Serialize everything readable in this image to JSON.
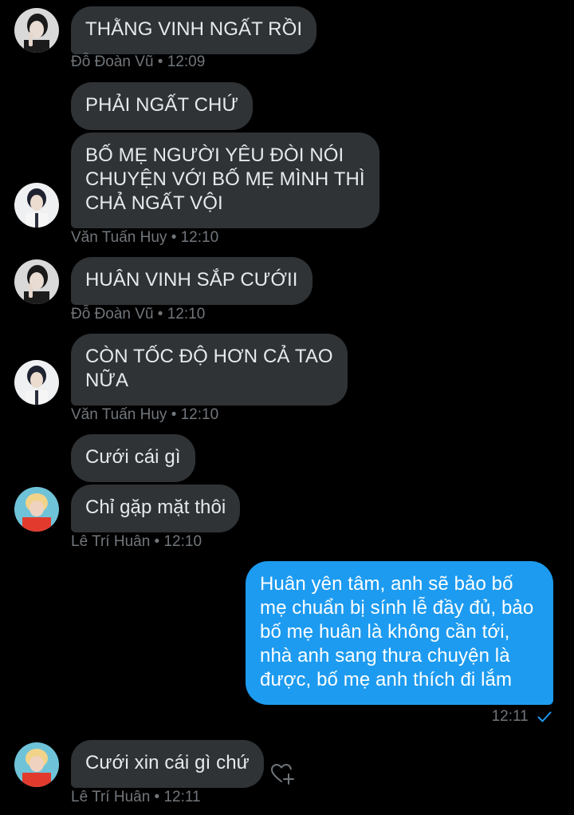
{
  "messages": [
    {
      "sender": "Đỗ Đoàn Vũ",
      "text": "THẰNG VINH NGẤT RỒI",
      "meta": "Đỗ Đoàn Vũ • 12:09"
    },
    {
      "sender": "Văn Tuấn Huy",
      "text": "PHẢI NGẤT CHỨ"
    },
    {
      "sender": "Văn Tuấn Huy",
      "text": "BỐ MẸ NGƯỜI YÊU ĐÒI NÓI\nCHUYỆN VỚI BỐ MẸ MÌNH THÌ\nCHẢ NGẤT VỘI",
      "meta": "Văn Tuấn Huy • 12:10"
    },
    {
      "sender": "Đỗ Đoàn Vũ",
      "text": "HUÂN VINH SẮP CƯỚII",
      "meta": "Đỗ Đoàn Vũ • 12:10"
    },
    {
      "sender": "Văn Tuấn Huy",
      "text": "CÒN TỐC ĐỘ HƠN CẢ TAO\nNỮA",
      "meta": "Văn Tuấn Huy • 12:10"
    },
    {
      "sender": "Lê Trí Huân",
      "text": "Cưới cái gì"
    },
    {
      "sender": "Lê Trí Huân",
      "text": "Chỉ gặp mặt thôi",
      "meta": "Lê Trí Huân • 12:10"
    },
    {
      "sender": "me",
      "text": "Huân yên tâm, anh sẽ bảo bố\nmẹ chuẩn bị sính lễ đầy đủ, bảo\nbố mẹ huân là không cần tới,\nnhà anh sang thưa chuyện là\nđược, bố mẹ anh thích đi lắm",
      "meta": "12:11"
    },
    {
      "sender": "Lê Trí Huân",
      "text": "Cưới xin cái gì chứ",
      "meta": "Lê Trí Huân • 12:11"
    }
  ],
  "colors": {
    "background": "#000000",
    "incoming_bubble": "#2f3336",
    "outgoing_bubble": "#1d9bf0",
    "meta_text": "#71767b",
    "read_check": "#1d9bf0"
  },
  "icons": {
    "read_receipt": "checkmark-icon",
    "add_reaction": "heart-plus-icon"
  }
}
